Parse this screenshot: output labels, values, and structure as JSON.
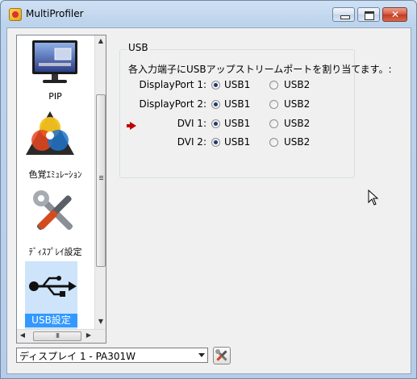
{
  "window": {
    "title": "MultiProfiler"
  },
  "sidebar": {
    "items": [
      {
        "label": "PIP",
        "icon": "monitor-icon",
        "selected": false
      },
      {
        "label": "色覚ｴﾐｭﾚｰｼｮﾝ",
        "icon": "color-wheel-icon",
        "selected": false
      },
      {
        "label": "ﾃﾞｨｽﾌﾟﾚｲ設定",
        "icon": "tools-icon",
        "selected": false
      },
      {
        "label": "USB設定",
        "icon": "usb-icon",
        "selected": true
      }
    ]
  },
  "usb": {
    "group_title": "USB",
    "description": "各入力端子にUSBアップストリームポートを割り当てます。:",
    "rows": [
      {
        "label": "DisplayPort 1:",
        "option1": "USB1",
        "option2": "USB2",
        "selected": "USB1",
        "current": false
      },
      {
        "label": "DisplayPort 2:",
        "option1": "USB1",
        "option2": "USB2",
        "selected": "USB1",
        "current": false
      },
      {
        "label": "DVI 1:",
        "option1": "USB1",
        "option2": "USB2",
        "selected": "USB1",
        "current": true
      },
      {
        "label": "DVI 2:",
        "option1": "USB1",
        "option2": "USB2",
        "selected": "USB1",
        "current": false
      }
    ]
  },
  "footer": {
    "display_select": "ディスプレイ 1 - PA301W"
  },
  "colors": {
    "selection": "#3399ff",
    "current_marker": "#c00000"
  }
}
